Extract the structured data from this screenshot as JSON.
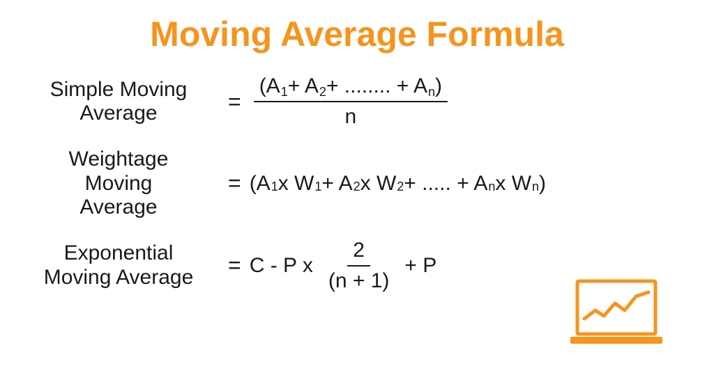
{
  "title": "Moving Average Formula",
  "formulas": {
    "sma": {
      "label_l1": "Simple Moving",
      "label_l2": "Average",
      "eq": "=",
      "num_open": "(A",
      "num_s1": "1",
      "num_plus1": "+ A",
      "num_s2": "2",
      "num_dots": "+ ........ + A",
      "num_sn": "n",
      "num_close": ")",
      "den": "n"
    },
    "wma": {
      "label_l1": "Weightage",
      "label_l2": "Moving",
      "label_l3": "Average",
      "eq": "=",
      "open": "(A",
      "s1": "1",
      "xw1a": " x W",
      "sw1": "1",
      "plus_a2": " + A",
      "s2": "2",
      "xw2a": " x W",
      "sw2": "2",
      "dots": " + ..... + A",
      "sn": "n",
      "xwna": " x W",
      "swn": "n",
      "close": ")"
    },
    "ema": {
      "label_l1": "Exponential",
      "label_l2": "Moving Average",
      "eq": "=",
      "pre": "C - P x",
      "num": "2",
      "den": "(n + 1)",
      "post": "+ P"
    }
  },
  "colors": {
    "accent": "#f7941d"
  }
}
